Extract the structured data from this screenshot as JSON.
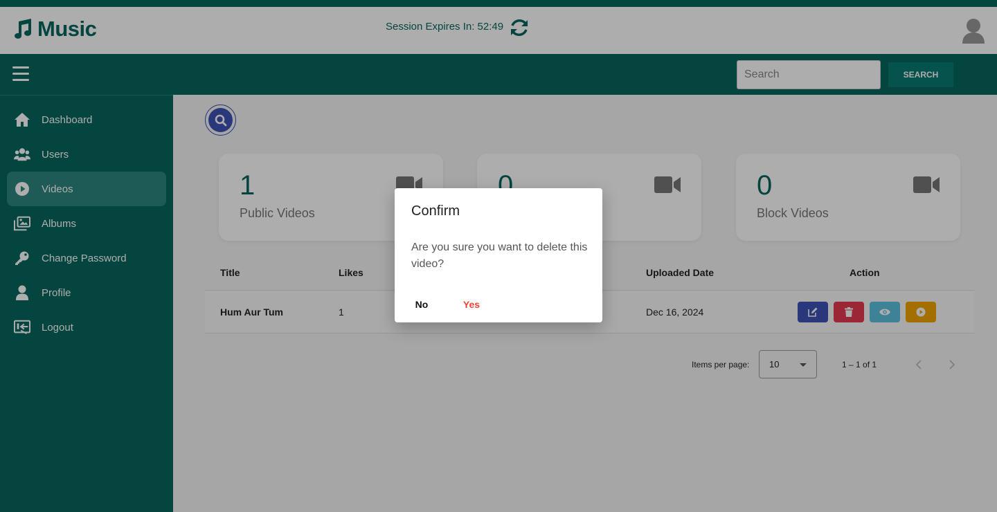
{
  "app": {
    "name": "Music"
  },
  "header": {
    "session_text": "Session Expires In: 52:49"
  },
  "navbar": {
    "search_placeholder": "Search",
    "search_button": "SEARCH"
  },
  "sidebar": {
    "items": [
      {
        "label": "Dashboard",
        "icon": "home-icon"
      },
      {
        "label": "Users",
        "icon": "users-icon"
      },
      {
        "label": "Videos",
        "icon": "play-circle-icon",
        "active": true
      },
      {
        "label": "Albums",
        "icon": "albums-icon"
      },
      {
        "label": "Change Password",
        "icon": "key-icon"
      },
      {
        "label": "Profile",
        "icon": "user-icon"
      },
      {
        "label": "Logout",
        "icon": "logout-icon"
      }
    ]
  },
  "cards": [
    {
      "value": "1",
      "label": "Public Videos"
    },
    {
      "value": "0",
      "label": ""
    },
    {
      "value": "0",
      "label": "Block Videos"
    }
  ],
  "table": {
    "headers": {
      "title": "Title",
      "likes": "Likes",
      "uploaded": "Uploaded Date",
      "action": "Action"
    },
    "rows": [
      {
        "title": "Hum Aur Tum",
        "likes": "1",
        "uploaded": "Dec 16, 2024"
      }
    ]
  },
  "pagination": {
    "items_per_page_label": "Items per page:",
    "items_per_page": "10",
    "range": "1 – 1 of 1"
  },
  "dialog": {
    "title": "Confirm",
    "message": "Are you sure you want to delete this video?",
    "no": "No",
    "yes": "Yes"
  },
  "colors": {
    "primary": "#06665e",
    "edit": "#3f51b5",
    "delete": "#e53950",
    "view": "#5bc0de",
    "play": "#f0a500",
    "danger": "#f44336"
  }
}
